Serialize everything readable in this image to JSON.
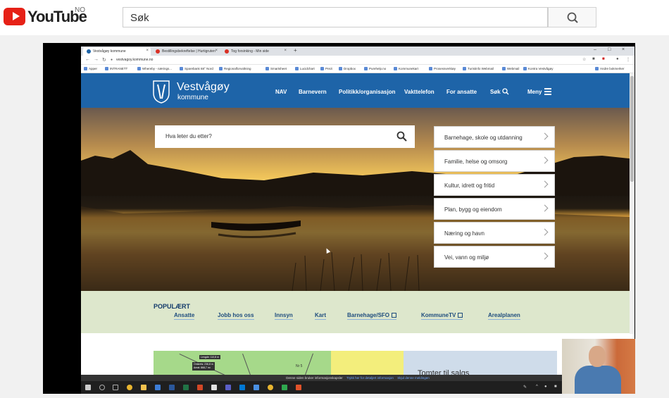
{
  "youtube": {
    "brand": "YouTube",
    "country": "NO",
    "search_placeholder": "Søk",
    "accent": "#e62117"
  },
  "browser": {
    "tabs": [
      {
        "label": "Vestvågøy kommune",
        "color": "#1e64a8",
        "active": true
      },
      {
        "label": "Bestillingsbekreftelse | Hurtigruten",
        "color": "#d93025",
        "active": false
      },
      {
        "label": "Tog forsinking - Min side",
        "color": "#d93025",
        "active": false
      }
    ],
    "url": "vestvagoy.kommune.no",
    "bookmarks": [
      "Apper",
      "INTRANETT",
      "Whereby - nærings...",
      "Sparebank 68° Nord",
      "Regionalforvaltning",
      "Smartsheet",
      "Lucidchart",
      "Prezi",
      "Dropbox",
      "Purehelp.no",
      "Kommunekart",
      "Prosessverktøy",
      "Turistinfo Webmail",
      "Webmail",
      "Kontra Vestvågøy"
    ],
    "other_bookmarks": "Andre bokmerker"
  },
  "site": {
    "name": "Vestvågøy",
    "sub": "kommune",
    "brand_color": "#1e64a8",
    "nav": [
      "NAV",
      "Barnevern",
      "Politikk/organisasjon",
      "Vakttelefon",
      "For ansatte",
      "Søk",
      "Meny"
    ],
    "search_placeholder": "Hva leter du etter?",
    "categories": [
      "Barnehage, skole og utdanning",
      "Familie, helse og omsorg",
      "Kultur, idrett og fritid",
      "Plan, bygg og eiendom",
      "Næring og havn",
      "Vei, vann og miljø"
    ],
    "popular": {
      "title": "POPULÆRT",
      "links": [
        "Ansatte",
        "Jobb hos oss",
        "Innsyn",
        "Kart",
        "Barnehage/SFO",
        "KommuneTV",
        "Arealplanen"
      ]
    },
    "map": {
      "tooltip_top": "Lengde: 110,8 m",
      "tooltip_mid": "Omkrets: 236,8 m",
      "tooltip_bot": "Areal: 868,7 m²",
      "plot_label": "Nr 5"
    },
    "promo": "Tomter til salgs",
    "cookie_text": "Denne siden bruker informasjonskapsler",
    "cookie_link1": "Trykk her for detaljert informasjon",
    "cookie_link2": "Skjul denne meldingen"
  }
}
